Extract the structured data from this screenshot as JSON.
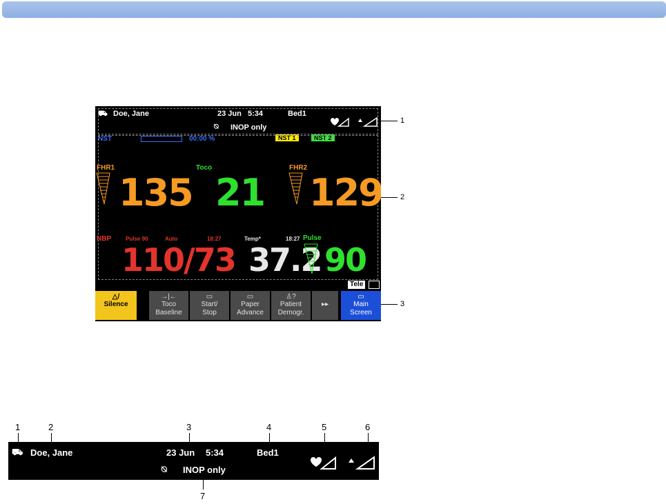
{
  "header": {
    "patient_name": "Doe, Jane",
    "date": "23 Jun",
    "time": "5:34",
    "bed": "Bed1",
    "alarm_status": "INOP only"
  },
  "status_bar": {
    "nst_label": "NST",
    "nst_timer": "00:00 %",
    "nst1": "NST 1",
    "nst2": "NST 2"
  },
  "parameters": {
    "fhr1": {
      "label": "FHR1",
      "value": "135"
    },
    "toco": {
      "label": "Toco",
      "value": "21"
    },
    "fhr2": {
      "label": "FHR2",
      "value": "129"
    },
    "nbp": {
      "label": "NBP",
      "pulse_note": "Pulse 90",
      "mode": "Auto",
      "time": "18:27",
      "value": "110/73"
    },
    "temp": {
      "label": "Temp*",
      "value": "37.2"
    },
    "pulse": {
      "label": "Pulse",
      "time": "18:27",
      "value": "90"
    }
  },
  "tele_badge": "Tele",
  "smartkeys": {
    "silence": "Silence",
    "toco_baseline": [
      "Toco",
      "Baseline"
    ],
    "start_stop": [
      "Start/",
      "Stop"
    ],
    "paper_advance": [
      "Paper",
      "Advance"
    ],
    "patient_demogr": [
      "Patient",
      "Demogr."
    ],
    "more": "▸▸",
    "main_screen": [
      "Main",
      "Screen"
    ]
  },
  "callouts_top": [
    "1",
    "2",
    "3"
  ],
  "callouts_bottom": [
    "1",
    "2",
    "3",
    "4",
    "5",
    "6",
    "7"
  ],
  "colors": {
    "fhr": "#f59a23",
    "toco": "#2fe02f",
    "nbp": "#e3342c",
    "silence": "#f2c51c",
    "main_screen": "#1c4fd8"
  }
}
